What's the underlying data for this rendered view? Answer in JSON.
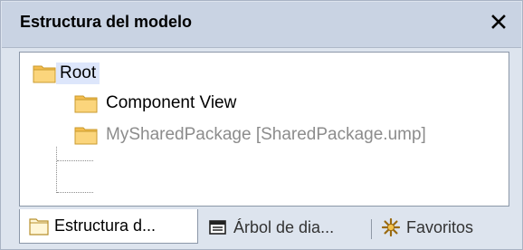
{
  "panel": {
    "title": "Estructura del modelo",
    "close_icon": "close-icon"
  },
  "tree": {
    "root": {
      "label": "Root",
      "icon": "folder-icon"
    },
    "children": [
      {
        "label": "Component View",
        "icon": "folder-icon",
        "muted": false
      },
      {
        "label": "MySharedPackage [SharedPackage.ump]",
        "icon": "folder-icon",
        "muted": true
      }
    ]
  },
  "tabs": [
    {
      "label": "Estructura d...",
      "icon": "model-tree-icon",
      "active": true
    },
    {
      "label": "Árbol de dia...",
      "icon": "diagram-tree-icon",
      "active": false
    },
    {
      "label": "Favoritos",
      "icon": "favorites-icon",
      "active": false
    }
  ],
  "colors": {
    "title_bar": "#c9d3e3",
    "selection": "#dde6fb",
    "folder": "#f8c65a",
    "muted_text": "#8c8c8c"
  }
}
